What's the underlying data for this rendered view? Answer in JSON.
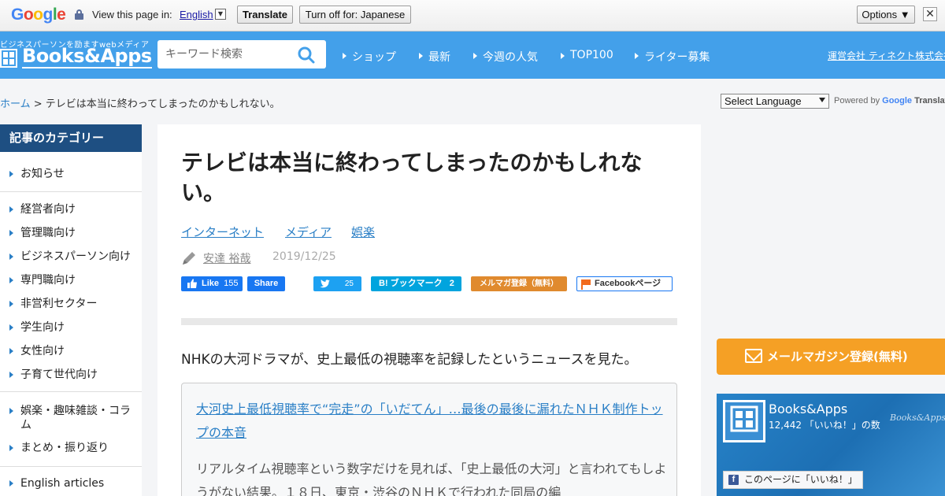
{
  "translate_bar": {
    "logo": "Google",
    "view_text": "View this page in:",
    "language": "English",
    "translate_label": "Translate",
    "turn_off_label": "Turn off for: Japanese",
    "options_label": "Options ▼",
    "close_label": "✕"
  },
  "header": {
    "tagline": "ビジネスパーソンを励ますwebメディア",
    "logo_text": "Books&Apps",
    "search_placeholder": "キーワード検索",
    "nav": [
      "ショップ",
      "最新",
      "今週の人気",
      "TOP100",
      "ライター募集"
    ],
    "corporate_link": "運営会社 ティネクト株式会社"
  },
  "breadcrumb": {
    "home": "ホーム",
    "separator": " > ",
    "current": "テレビは本当に終わってしまったのかもしれない。"
  },
  "translate_widget": {
    "select_label": "Select Language",
    "powered_by": "Powered by",
    "google": "Google",
    "translate": "Translate"
  },
  "sidebar": {
    "title": "記事のカテゴリー",
    "categories": [
      "お知らせ",
      "経営者向け",
      "管理職向け",
      "ビジネスパーソン向け",
      "専門職向け",
      "非営利セクター",
      "学生向け",
      "女性向け",
      "子育て世代向け",
      "娯楽・趣味雑談・コラム",
      "まとめ・振り返り",
      "English articles"
    ]
  },
  "article": {
    "title": "テレビは本当に終わってしまったのかもしれない。",
    "tags": [
      "インターネット",
      "メディア",
      "娯楽"
    ],
    "author": "安達 裕哉",
    "date": "2019/12/25",
    "share": {
      "fb_like": "Like",
      "fb_like_count": "155",
      "fb_share": "Share",
      "tw_count": "25",
      "hatena_label": "B! ブックマーク",
      "hatena_count": "2",
      "mailmag": "メルマガ登録（無料）",
      "fb_page": "Facebookページ"
    },
    "lead": "NHKの大河ドラマが、史上最低の視聴率を記録したというニュースを見た。",
    "quote_link": "大河史上最低視聴率で“完走”の「いだてん」…最後の最後に漏れたＮＨＫ制作トップの本音",
    "quote_text": "リアルタイム視聴率という数字だけを見れば、「史上最低の大河」と言われてもしようがない結果。１８日、東京・渋谷のＮＨＫで行われた同局の編"
  },
  "right": {
    "mail_cta": "メールマガジン登録(無料)",
    "fb_widget": {
      "name": "Books&Apps",
      "count": "12,442 「いいね！」の数",
      "watermark": "Books&Apps",
      "like_button": "このページに「いいね！」"
    }
  },
  "colors": {
    "header_blue": "#43a0ea",
    "sidebar_title": "#1e4f82",
    "link_blue": "#2a7fc6",
    "cta_orange": "#f5a025"
  }
}
